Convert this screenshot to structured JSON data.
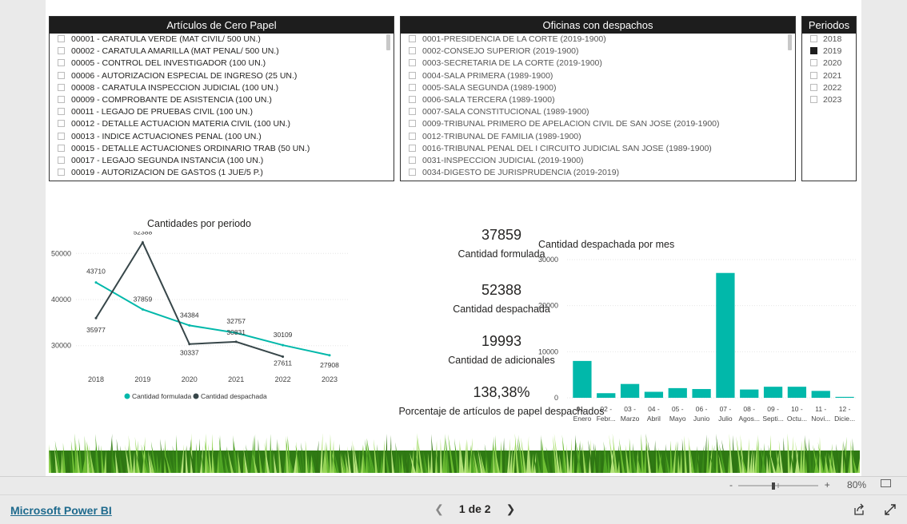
{
  "slicers": {
    "articulos": {
      "title": "Artículos de Cero Papel",
      "items": [
        "00001 - CARATULA VERDE (MAT CIVIL/ 500 UN.)",
        "00002 - CARATULA AMARILLA (MAT PENAL/ 500 UN.)",
        "00005 - CONTROL DEL INVESTIGADOR (100 UN.)",
        "00006 - AUTORIZACION ESPECIAL DE INGRESO (25 UN.)",
        "00008 - CARATULA INSPECCION JUDICIAL (100 UN.)",
        "00009 - COMPROBANTE DE ASISTENCIA (100 UN.)",
        "00011 - LEGAJO DE PRUEBAS CIVIL (100 UN.)",
        "00012 - DETALLE ACTUACION MATERIA CIVIL (100 UN.)",
        "00013 - INDICE ACTUACIONES PENAL (100 UN.)",
        "00015 - DETALLE ACTUACIONES ORDINARIO TRAB (50 UN.)",
        "00017 - LEGAJO SEGUNDA INSTANCIA (100 UN.)",
        "00019 - AUTORIZACION DE GASTOS (1 JUE/5 P.)"
      ]
    },
    "oficinas": {
      "title": "Oficinas con despachos",
      "items": [
        "0001-PRESIDENCIA DE LA CORTE (2019-1900)",
        "0002-CONSEJO SUPERIOR (2019-1900)",
        "0003-SECRETARIA DE LA CORTE (2019-1900)",
        "0004-SALA PRIMERA (1989-1900)",
        "0005-SALA SEGUNDA (1989-1900)",
        "0006-SALA TERCERA (1989-1900)",
        "0007-SALA CONSTITUCIONAL (1989-1900)",
        "0009-TRIBUNAL PRIMERO DE APELACION CIVIL DE SAN JOSE (2019-1900)",
        "0012-TRIBUNAL DE FAMILIA (1989-1900)",
        "0016-TRIBUNAL PENAL DEL I CIRCUITO JUDICIAL SAN JOSE (1989-1900)",
        "0031-INSPECCION JUDICIAL (2019-1900)",
        "0034-DIGESTO DE JURISPRUDENCIA (2019-2019)"
      ]
    },
    "periodos": {
      "title": "Periodos",
      "items": [
        "2018",
        "2019",
        "2020",
        "2021",
        "2022",
        "2023"
      ],
      "selected": "2019"
    }
  },
  "line_chart": {
    "title": "Cantidades por periodo",
    "legend": [
      "Cantidad formulada",
      "Cantidad despachada"
    ],
    "y_ticks": [
      "50000",
      "40000",
      "30000"
    ]
  },
  "kpis": [
    {
      "value": "37859",
      "label": "Cantidad formulada"
    },
    {
      "value": "52388",
      "label": "Cantidad despachada"
    },
    {
      "value": "19993",
      "label": "Cantidad de adicionales"
    },
    {
      "value": "138,38%",
      "label": "Porcentaje de artículos de papel despachados"
    }
  ],
  "bar_chart": {
    "title": "Cantidad despachada por mes",
    "y_ticks": [
      "30000",
      "20000",
      "10000",
      "0"
    ]
  },
  "chart_data": [
    {
      "type": "line",
      "title": "Cantidades por periodo",
      "x": [
        "2018",
        "2019",
        "2020",
        "2021",
        "2022",
        "2023"
      ],
      "ylim": [
        27000,
        53000
      ],
      "grid": true,
      "legend": "bottom",
      "series": [
        {
          "name": "Cantidad formulada",
          "color": "#01b8aa",
          "values": [
            43710,
            37859,
            34384,
            32757,
            30109,
            27908
          ]
        },
        {
          "name": "Cantidad despachada",
          "color": "#374649",
          "values": [
            35977,
            52388,
            30337,
            30831,
            27611,
            null
          ]
        }
      ]
    },
    {
      "type": "bar",
      "title": "Cantidad despachada por mes",
      "categories": [
        "01 - Enero",
        "02 - Febr...",
        "03 - Marzo",
        "04 - Abril",
        "05 - Mayo",
        "06 - Junio",
        "07 - Julio",
        "08 - Agos...",
        "09 - Septi...",
        "10 - Octu...",
        "11 - Novi...",
        "12 - Dicie..."
      ],
      "values": [
        8000,
        1000,
        3000,
        1300,
        2100,
        1900,
        27100,
        1800,
        2400,
        2400,
        1500,
        200
      ],
      "ylim": [
        0,
        30000
      ],
      "grid": true,
      "color": "#01b8aa"
    }
  ],
  "footer": {
    "brand": "Microsoft Power BI",
    "page_indicator": "1 de 2",
    "zoom": "80%"
  }
}
